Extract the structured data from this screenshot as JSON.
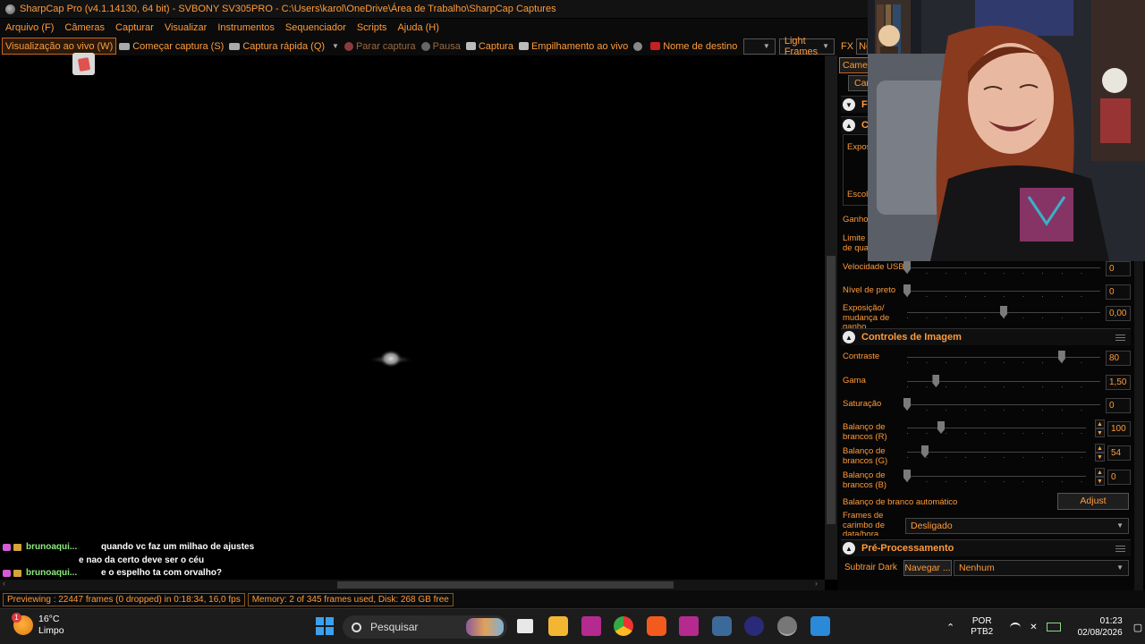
{
  "window": {
    "title": "SharpCap Pro (v4.1.14130, 64 bit) - SVBONY SV305PRO - C:\\Users\\karol\\OneDrive\\Área de Trabalho\\SharpCap Captures"
  },
  "menu": [
    "Arquivo (F)",
    "Câmeras",
    "Capturar",
    "Visualizar",
    "Instrumentos",
    "Sequenciador",
    "Scripts",
    "Ajuda (H)"
  ],
  "toolbar": {
    "live_view": "Visualização ao vivo (W)",
    "start_capture": "Começar captura (S)",
    "quick_capture": "Captura rápida (Q)",
    "stop_capture": "Parar captura",
    "pause": "Pausa",
    "snapshot": "Captura",
    "live_stack": "Empilhamento ao vivo",
    "target_name": "Nome de destino",
    "target_value": "",
    "frame_type": "Light Frames",
    "fx": "FX",
    "fx_value": "Nenh"
  },
  "chat": [
    {
      "user": "brunoaqui...",
      "message": "quando vc faz um milhao de ajustes"
    },
    {
      "user": "",
      "message": "e nao da certo deve ser o céu"
    },
    {
      "user": "brunoaqui...",
      "message": "e o espelho ta com orvalho?"
    }
  ],
  "panel": {
    "camera_tab": "Camer",
    "camera_btn": "Car",
    "section_f": "F",
    "section_c": "C",
    "exposure_label": "Expos",
    "choose_label": "Escol",
    "gain_label": "Ganho",
    "limit_label": "Limite de qua",
    "usb_speed": {
      "label": "Velocidade USB",
      "value": "0",
      "pos": 0.0
    },
    "black_level": {
      "label": "Nível de preto",
      "value": "0",
      "pos": 0.0
    },
    "exposure_gain": {
      "label": "Exposição/ mudança de ganho",
      "value": "0,00",
      "pos": 0.5
    },
    "image_controls": {
      "title": "Controles de Imagem",
      "contrast": {
        "label": "Contraste",
        "value": "80",
        "pos": 0.8
      },
      "gamma": {
        "label": "Gama",
        "value": "1,50",
        "pos": 0.15
      },
      "saturation": {
        "label": "Saturação",
        "value": "0",
        "pos": 0.0
      },
      "wb_r": {
        "label": "Balanço de brancos (R)",
        "value": "100",
        "pos": 0.19
      },
      "wb_g": {
        "label": "Balanço de brancos (G)",
        "value": "54",
        "pos": 0.1
      },
      "wb_b": {
        "label": "Balanço de brancos (B)",
        "value": "0",
        "pos": 0.0
      },
      "auto_wb_label": "Balanço de branco automático",
      "adjust_btn": "Adjust",
      "timestamp_label": "Frames de carimbo de data/hora",
      "timestamp_value": "Desligado"
    },
    "preprocessing": {
      "title": "Pré-Processamento",
      "subtract_dark_label": "Subtrair Dark",
      "browse_btn": "Navegar ...",
      "dark_value": "Nenhum"
    }
  },
  "status": {
    "preview": "Previewing : 22447 frames (0 dropped) in 0:18:34, 16,0 fps",
    "memory": "Memory: 2 of 345 frames used, Disk: 268 GB free"
  },
  "taskbar": {
    "weather_temp": "16°C",
    "weather_desc": "Limpo",
    "weather_badge": "1",
    "search_placeholder": "Pesquisar",
    "lang_1": "POR",
    "lang_2": "PTB2",
    "time": "01:23",
    "date": "02/08/2026"
  },
  "colors": {
    "accent": "#ff9b3a",
    "background": "#000000"
  }
}
